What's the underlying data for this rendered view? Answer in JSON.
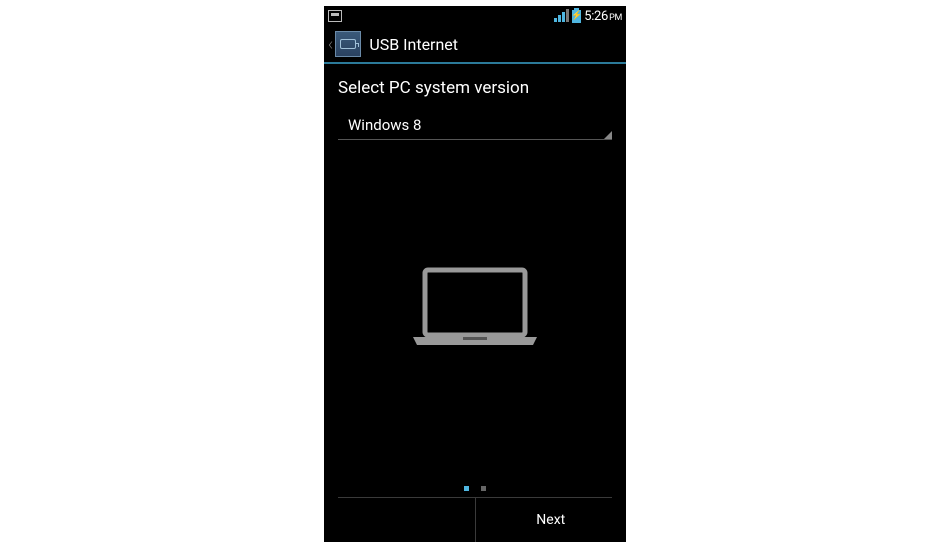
{
  "statusBar": {
    "time": "5:26",
    "timeSuffix": "PM"
  },
  "header": {
    "title": "USB Internet"
  },
  "content": {
    "prompt": "Select PC system version",
    "dropdownValue": "Windows 8"
  },
  "footer": {
    "nextLabel": "Next"
  }
}
